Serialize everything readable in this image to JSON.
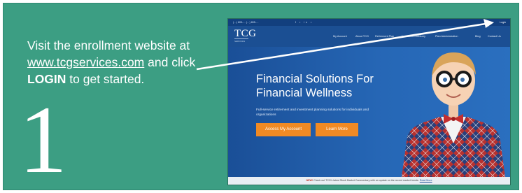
{
  "step": {
    "number": "1",
    "line_1": "Visit the enrollment website at ",
    "url": "www.tcgservices.com",
    "line_2": " and click ",
    "keyword": "LOGIN",
    "line_3": " to get started."
  },
  "site": {
    "topbar": {
      "contact": "(…) 805-…   (…) 805-…",
      "social": "f  •  in  •",
      "login_label": "Login"
    },
    "logo": {
      "text": "TCG",
      "tagline": "SERVICES"
    },
    "nav": [
      "My Account",
      "About TCG",
      "Retirement Plan",
      "Investment Advisory",
      "Plan Administration",
      "Blog",
      "Contact Us"
    ],
    "hero": {
      "title": "Financial Solutions For Financial Wellness",
      "description": "Full-service retirement and investment planning solutions for individuals and organizations",
      "primary_button": "Access My Account",
      "secondary_button": "Learn More"
    },
    "ticker": {
      "prefix": "NEW!",
      "text": " Check out TCG's latest Stock Market Commentary with an update on the recent market trends. ",
      "link": "Read More"
    }
  },
  "colors": {
    "panel": "#3c9e83",
    "site_blue": "#1b4f93",
    "button_orange": "#f08a24"
  }
}
